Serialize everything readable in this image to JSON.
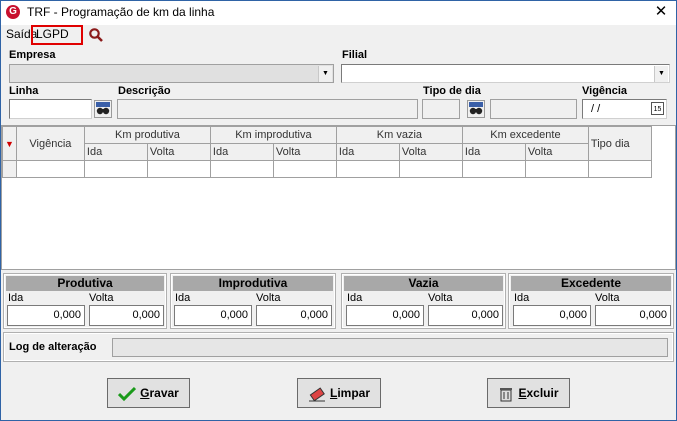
{
  "window": {
    "title": "TRF - Programação de km da linha",
    "close": "✕",
    "app_icon": "G"
  },
  "menu": {
    "saida": "Saída",
    "lgpd": "LGPD"
  },
  "form": {
    "empresa_label": "Empresa",
    "filial_label": "Filial",
    "linha_label": "Linha",
    "descricao_label": "Descrição",
    "tipo_dia_label": "Tipo de dia",
    "vigencia_label": "Vigência",
    "vigencia_value": " / /",
    "calendar_icon_text": "15"
  },
  "grid": {
    "vigencia": "Vigência",
    "km_produtiva": "Km produtiva",
    "km_improdutiva": "Km improdutiva",
    "km_vazia": "Km vazia",
    "km_excedente": "Km excedente",
    "tipo_dia": "Tipo dia",
    "ida": "Ida",
    "volta": "Volta"
  },
  "totals": {
    "produtiva": {
      "title": "Produtiva",
      "ida_label": "Ida",
      "volta_label": "Volta",
      "ida": "0,000",
      "volta": "0,000"
    },
    "improdutiva": {
      "title": "Improdutiva",
      "ida_label": "Ida",
      "volta_label": "Volta",
      "ida": "0,000",
      "volta": "0,000"
    },
    "vazia": {
      "title": "Vazia",
      "ida_label": "Ida",
      "volta_label": "Volta",
      "ida": "0,000",
      "volta": "0,000"
    },
    "excedente": {
      "title": "Excedente",
      "ida_label": "Ida",
      "volta_label": "Volta",
      "ida": "0,000",
      "volta": "0,000"
    }
  },
  "log": {
    "label": "Log de alteração"
  },
  "buttons": {
    "gravar_u": "G",
    "gravar_rest": "ravar",
    "limpar_u": "L",
    "limpar_rest": "impar",
    "excluir_u": "E",
    "excluir_rest": "xcluir"
  },
  "colors": {
    "close_red": "#e00000",
    "accent": "#c8102e",
    "check_green": "#1a9a1a"
  }
}
